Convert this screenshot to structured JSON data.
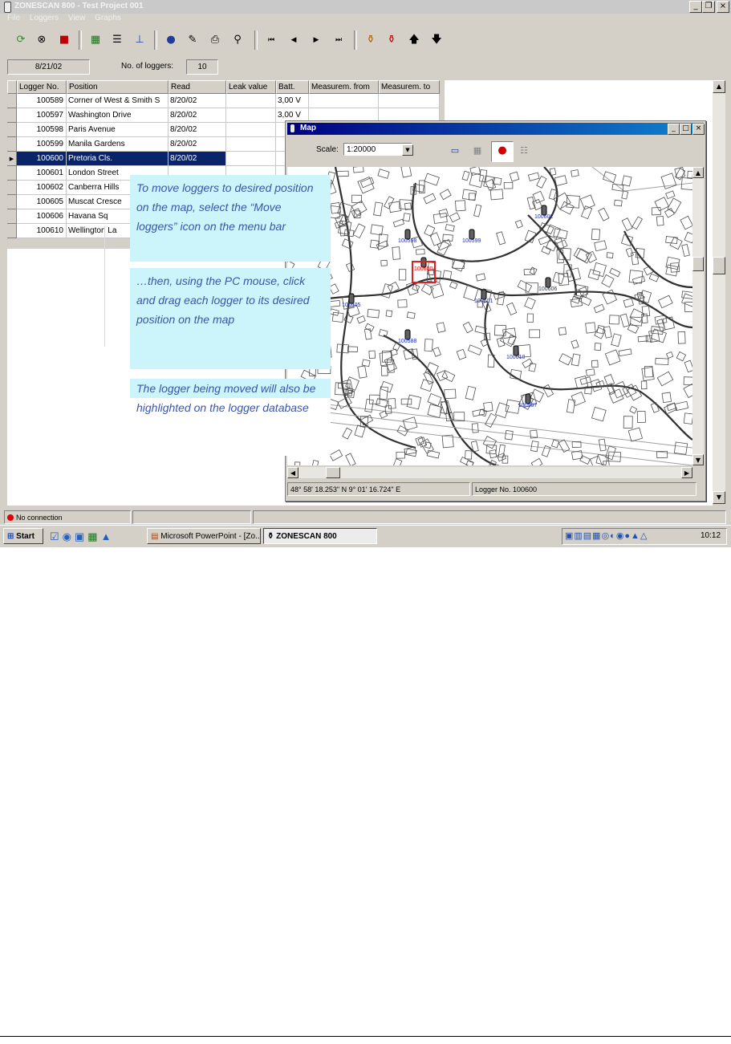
{
  "app": {
    "title": "ZONESCAN 800 - Test Project 001"
  },
  "menu": [
    "File",
    "Loggers",
    "View",
    "Graphs"
  ],
  "toolbar_icons": [
    "refresh-icon",
    "binoculars-icon",
    "record-icon",
    "table-icon",
    "list-icon",
    "tree-icon",
    "globe-icon",
    "edit-icon",
    "print-icon",
    "search-icon",
    "first-icon",
    "prev-icon",
    "next-icon",
    "last-icon",
    "logger-icon",
    "logger-red-icon",
    "up-arrow-icon",
    "down-arrow-icon"
  ],
  "info": {
    "date": "8/21/02",
    "loggers_label": "No. of loggers:",
    "loggers_count": "10"
  },
  "grid": {
    "columns": [
      "Logger No.",
      "Position",
      "Read",
      "Leak value",
      "Batt.",
      "Measurem. from",
      "Measurem. to"
    ],
    "rows": [
      [
        "100589",
        "Corner of West & Smith S",
        "8/20/02",
        "",
        "3,00 V",
        "",
        ""
      ],
      [
        "100597",
        "Washington Drive",
        "8/20/02",
        "",
        "3,00 V",
        "",
        ""
      ],
      [
        "100598",
        "Paris Avenue",
        "8/20/02",
        "",
        "",
        "",
        ""
      ],
      [
        "100599",
        "Manila Gardens",
        "8/20/02",
        "",
        "",
        "",
        ""
      ],
      [
        "100600",
        "Pretoria Cls.",
        "8/20/02",
        "",
        "",
        "",
        ""
      ],
      [
        "100601",
        "London Street",
        "",
        "",
        "",
        "",
        ""
      ],
      [
        "100602",
        "Canberra Hills",
        "",
        "",
        "",
        "",
        ""
      ],
      [
        "100605",
        "Muscat Cresce",
        "",
        "",
        "",
        "",
        ""
      ],
      [
        "100606",
        "Havana Sq",
        "",
        "",
        "",
        "",
        ""
      ],
      [
        "100610",
        "Wellington La",
        "",
        "",
        "",
        "",
        ""
      ]
    ],
    "selected_row": 4
  },
  "map": {
    "title": "Map",
    "scale_label": "Scale:",
    "scale_value": "1:20000",
    "coords": "48° 58' 18.253\" N   9° 01' 16.724\" E",
    "status": "Logger No. 100600",
    "markers": [
      "100598",
      "100599",
      "100602",
      "100600",
      "100601",
      "100605",
      "100588",
      "100606",
      "100610",
      "100597"
    ]
  },
  "callouts": {
    "c1": "To move loggers to desired position on the map, select the “Move loggers” icon on the menu bar",
    "c2": "…then, using the PC mouse, click and drag each logger to its desired position on the map",
    "c3": "The logger being moved will also be highlighted on the logger database"
  },
  "statusbar": {
    "connection": "No connection"
  },
  "taskbar": {
    "start": "Start",
    "tasks": [
      "Microsoft PowerPoint - [Zo...",
      "ZONESCAN 800"
    ],
    "clock": "10:12"
  },
  "colors": {
    "selection": "#0a246a",
    "callout_bg": "#ccf5fb",
    "callout_text": "#3a55a8",
    "map_title": "#000080"
  }
}
